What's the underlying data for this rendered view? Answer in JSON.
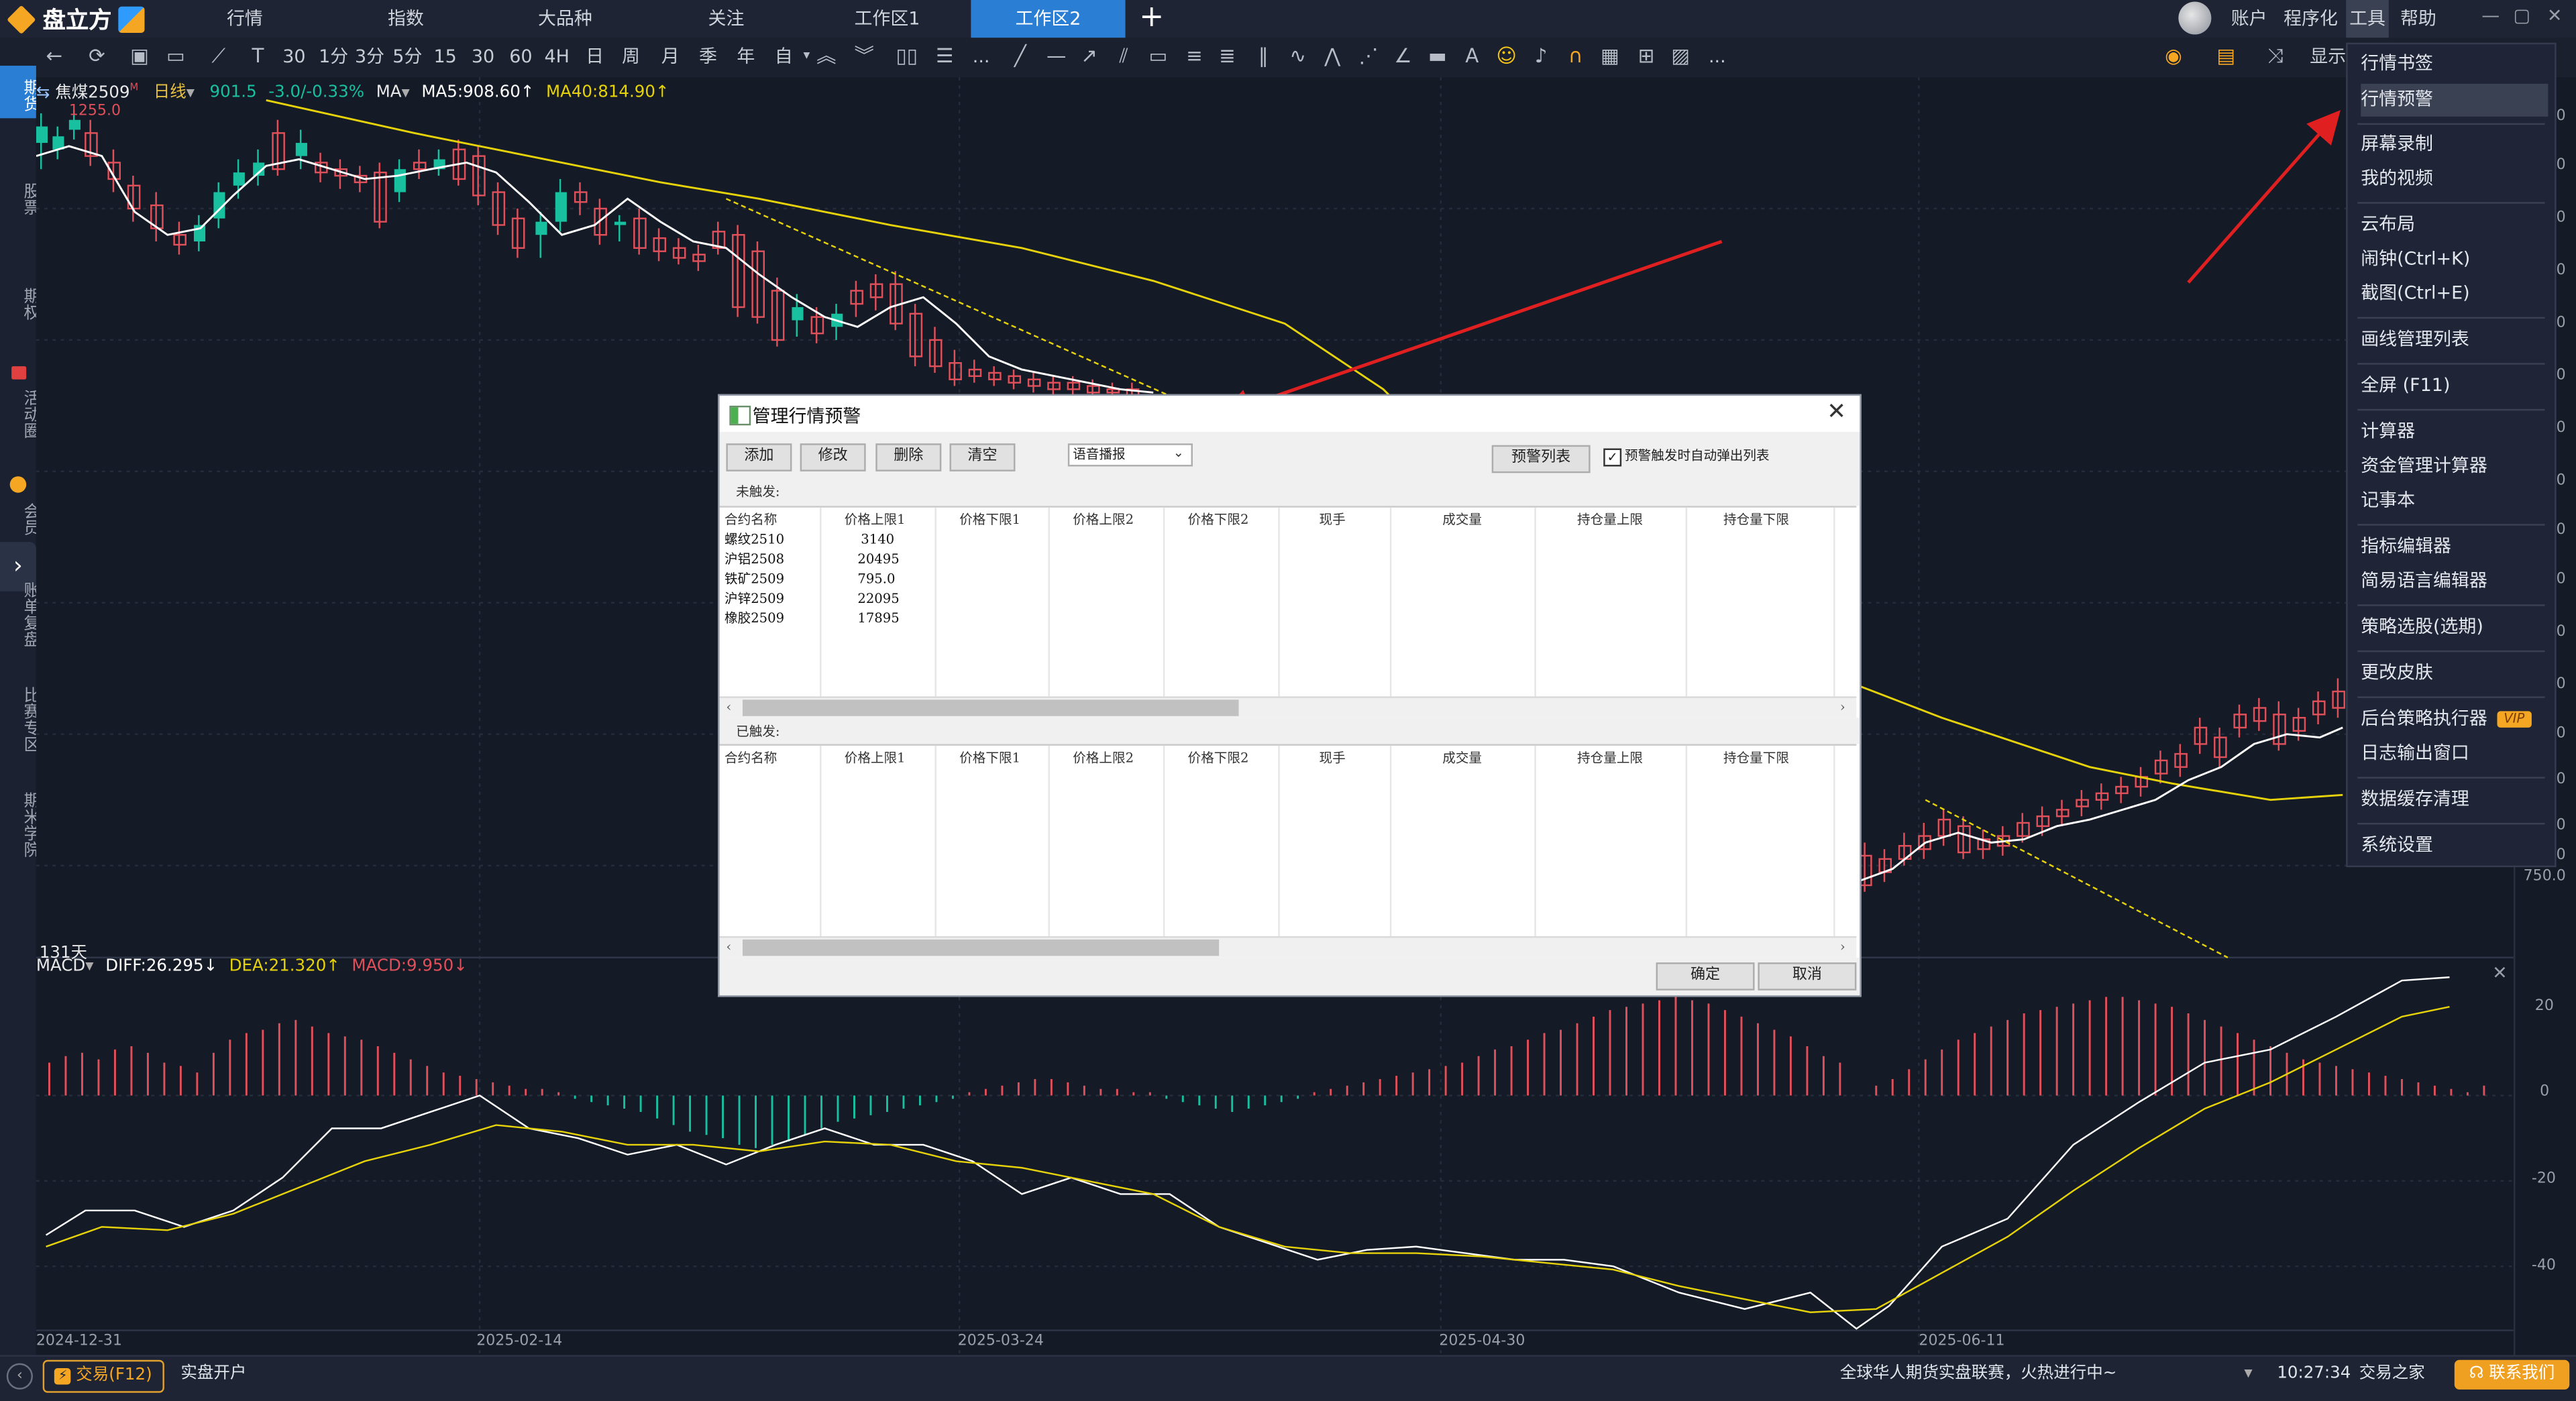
{
  "app": {
    "brand": "盘立方",
    "top_tabs": [
      "行情",
      "指数",
      "大品种",
      "关注",
      "工作区1",
      "工作区2"
    ],
    "add_tab": "+",
    "right_menus": [
      "账户",
      "程序化",
      "工具",
      "帮助"
    ],
    "window_buttons": [
      "—",
      "▢",
      "✕"
    ]
  },
  "toolbar": {
    "periods": [
      "30秒",
      "1分",
      "3分",
      "5分",
      "15分",
      "30分",
      "60分",
      "4H",
      "日",
      "周",
      "月",
      "季",
      "年",
      "自"
    ],
    "more": "...",
    "more2": "...",
    "display_label": "显示"
  },
  "left_rail": {
    "items": [
      "期货",
      "股票",
      "期权",
      "活动圈",
      "会员",
      "账单复盘",
      "比赛专区",
      "期米学院"
    ]
  },
  "chart": {
    "contract": "焦煤2509",
    "contract_sup": "M",
    "period": "日线",
    "price": "901.5",
    "change": "-3.0/-0.33%",
    "indicator": "MA",
    "ma5": "MA5:908.60↑",
    "ma40": "MA40:814.90↑",
    "high_label": "1255.0",
    "days_label": "131天",
    "axis_labels": [
      "0",
      "0",
      "0",
      "0",
      "0",
      "0",
      "0",
      "0",
      "0",
      "0",
      "0",
      "0",
      "0",
      "0",
      "0",
      "0",
      "0",
      "750.0"
    ],
    "macd": {
      "name": "MACD",
      "diff": "DIFF:26.295↓",
      "dea": "DEA:21.320↑",
      "macd": "MACD:9.950↓",
      "axis_labels": [
        "20",
        "0",
        "-20",
        "-40"
      ]
    },
    "dates": [
      "2024-12-31",
      "2025-02-14",
      "2025-03-24",
      "2025-04-30",
      "2025-06-11"
    ]
  },
  "tools_menu": {
    "items": [
      "行情书签",
      "行情预警",
      "屏幕录制",
      "我的视频",
      "云布局",
      "闹钟(Ctrl+K)",
      "截图(Ctrl+E)",
      "画线管理列表",
      "全屏 (F11)",
      "计算器",
      "资金管理计算器",
      "记事本",
      "指标编辑器",
      "简易语言编辑器",
      "策略选股(选期)",
      "更改皮肤",
      "后台策略执行器",
      "日志输出窗口",
      "数据缓存清理",
      "系统设置"
    ],
    "vip_badge": "VIP"
  },
  "dialog": {
    "title": "管理行情预警",
    "buttons": {
      "add": "添加",
      "edit": "修改",
      "delete": "删除",
      "clear": "清空"
    },
    "voice_mode": "语音播报",
    "alert_list": "预警列表",
    "auto_popup": "预警触发时自动弹出列表",
    "check_mark": "✓",
    "untriggered_label": "未触发:",
    "triggered_label": "已触发:",
    "columns": [
      "合约名称",
      "价格上限1",
      "价格下限1",
      "价格上限2",
      "价格下限2",
      "现手",
      "成交量",
      "持仓量上限",
      "持仓量下限"
    ],
    "rows": [
      {
        "name": "螺纹2510",
        "upper1": "3140"
      },
      {
        "name": "沪铝2508",
        "upper1": "20495"
      },
      {
        "name": "铁矿2509",
        "upper1": "795.0"
      },
      {
        "name": "沪锌2509",
        "upper1": "22095"
      },
      {
        "name": "橡胶2509",
        "upper1": "17895"
      }
    ],
    "ok": "确定",
    "cancel": "取消"
  },
  "status": {
    "trade": "交易(F12)",
    "open_account": "实盘开户",
    "news": "全球华人期货实盘联赛，火热进行中~",
    "time": "10:27:34",
    "trade_home": "交易之家",
    "contact": "联系我们"
  },
  "colors": {
    "accent": "#2a7fd4",
    "up": "#e0505a",
    "down": "#19c0a0",
    "ma_white": "#ffffff",
    "ma_yellow": "#e6d20a",
    "arrow": "#e02020"
  }
}
